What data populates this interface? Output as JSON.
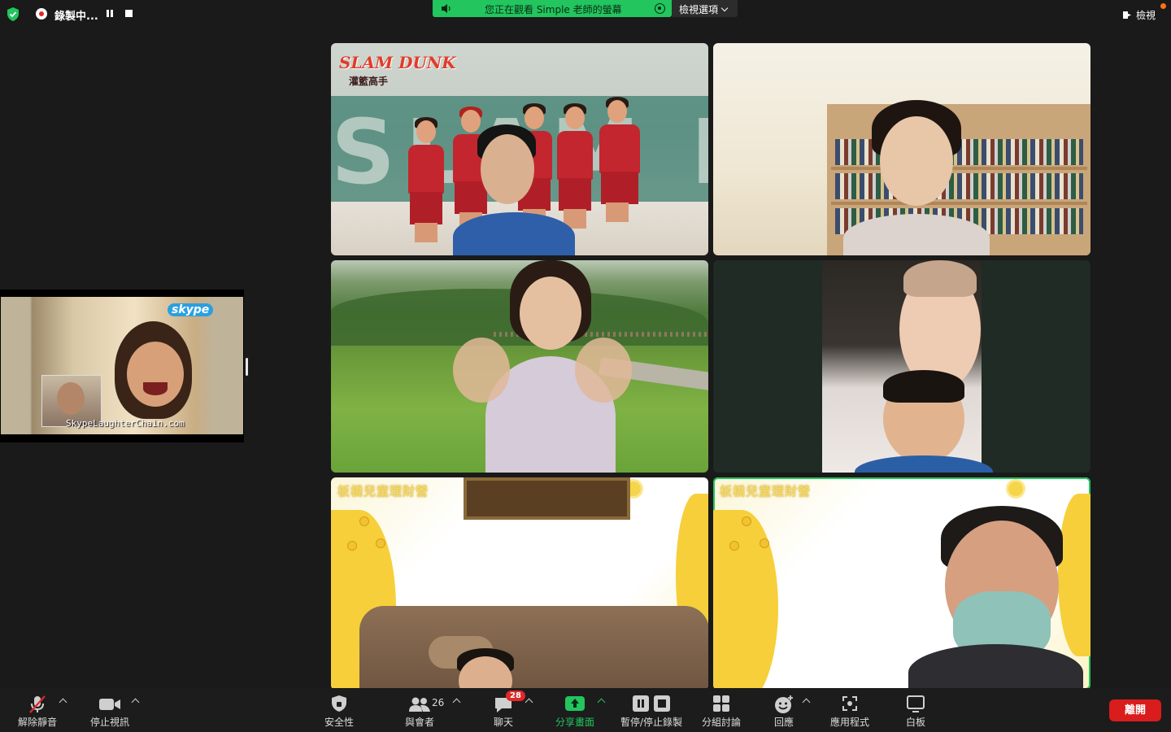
{
  "top_bar": {
    "recording_label": "錄製中...",
    "screen_share_banner": "您正在觀看 Simple 老師的螢幕",
    "view_options_label": "檢視選項",
    "view_label": "檢視"
  },
  "float_share": {
    "skype_logo": "skype",
    "caption": "SkypeLaughterChain.com"
  },
  "tiles": {
    "t1_logo": "SLAM DUNK",
    "t1_logo_sub": "灌籃高手",
    "t1_bg_letters": "SLAM DU",
    "t5_brand": "板橋兒童理財營",
    "t6_brand": "板橋兒童理財營"
  },
  "toolbar": {
    "unmute_label": "解除靜音",
    "stop_video_label": "停止視訊",
    "security_label": "安全性",
    "participants_label": "與會者",
    "participants_count": "26",
    "chat_label": "聊天",
    "chat_badge": "28",
    "share_label": "分享畫面",
    "record_label": "暫停/停止錄製",
    "breakout_label": "分組討論",
    "reactions_label": "回應",
    "apps_label": "應用程式",
    "whiteboard_label": "白板",
    "leave_label": "離開"
  },
  "colors": {
    "share_green": "#22c55e",
    "leave_red": "#d91c1c",
    "background": "#1a1a1a"
  }
}
